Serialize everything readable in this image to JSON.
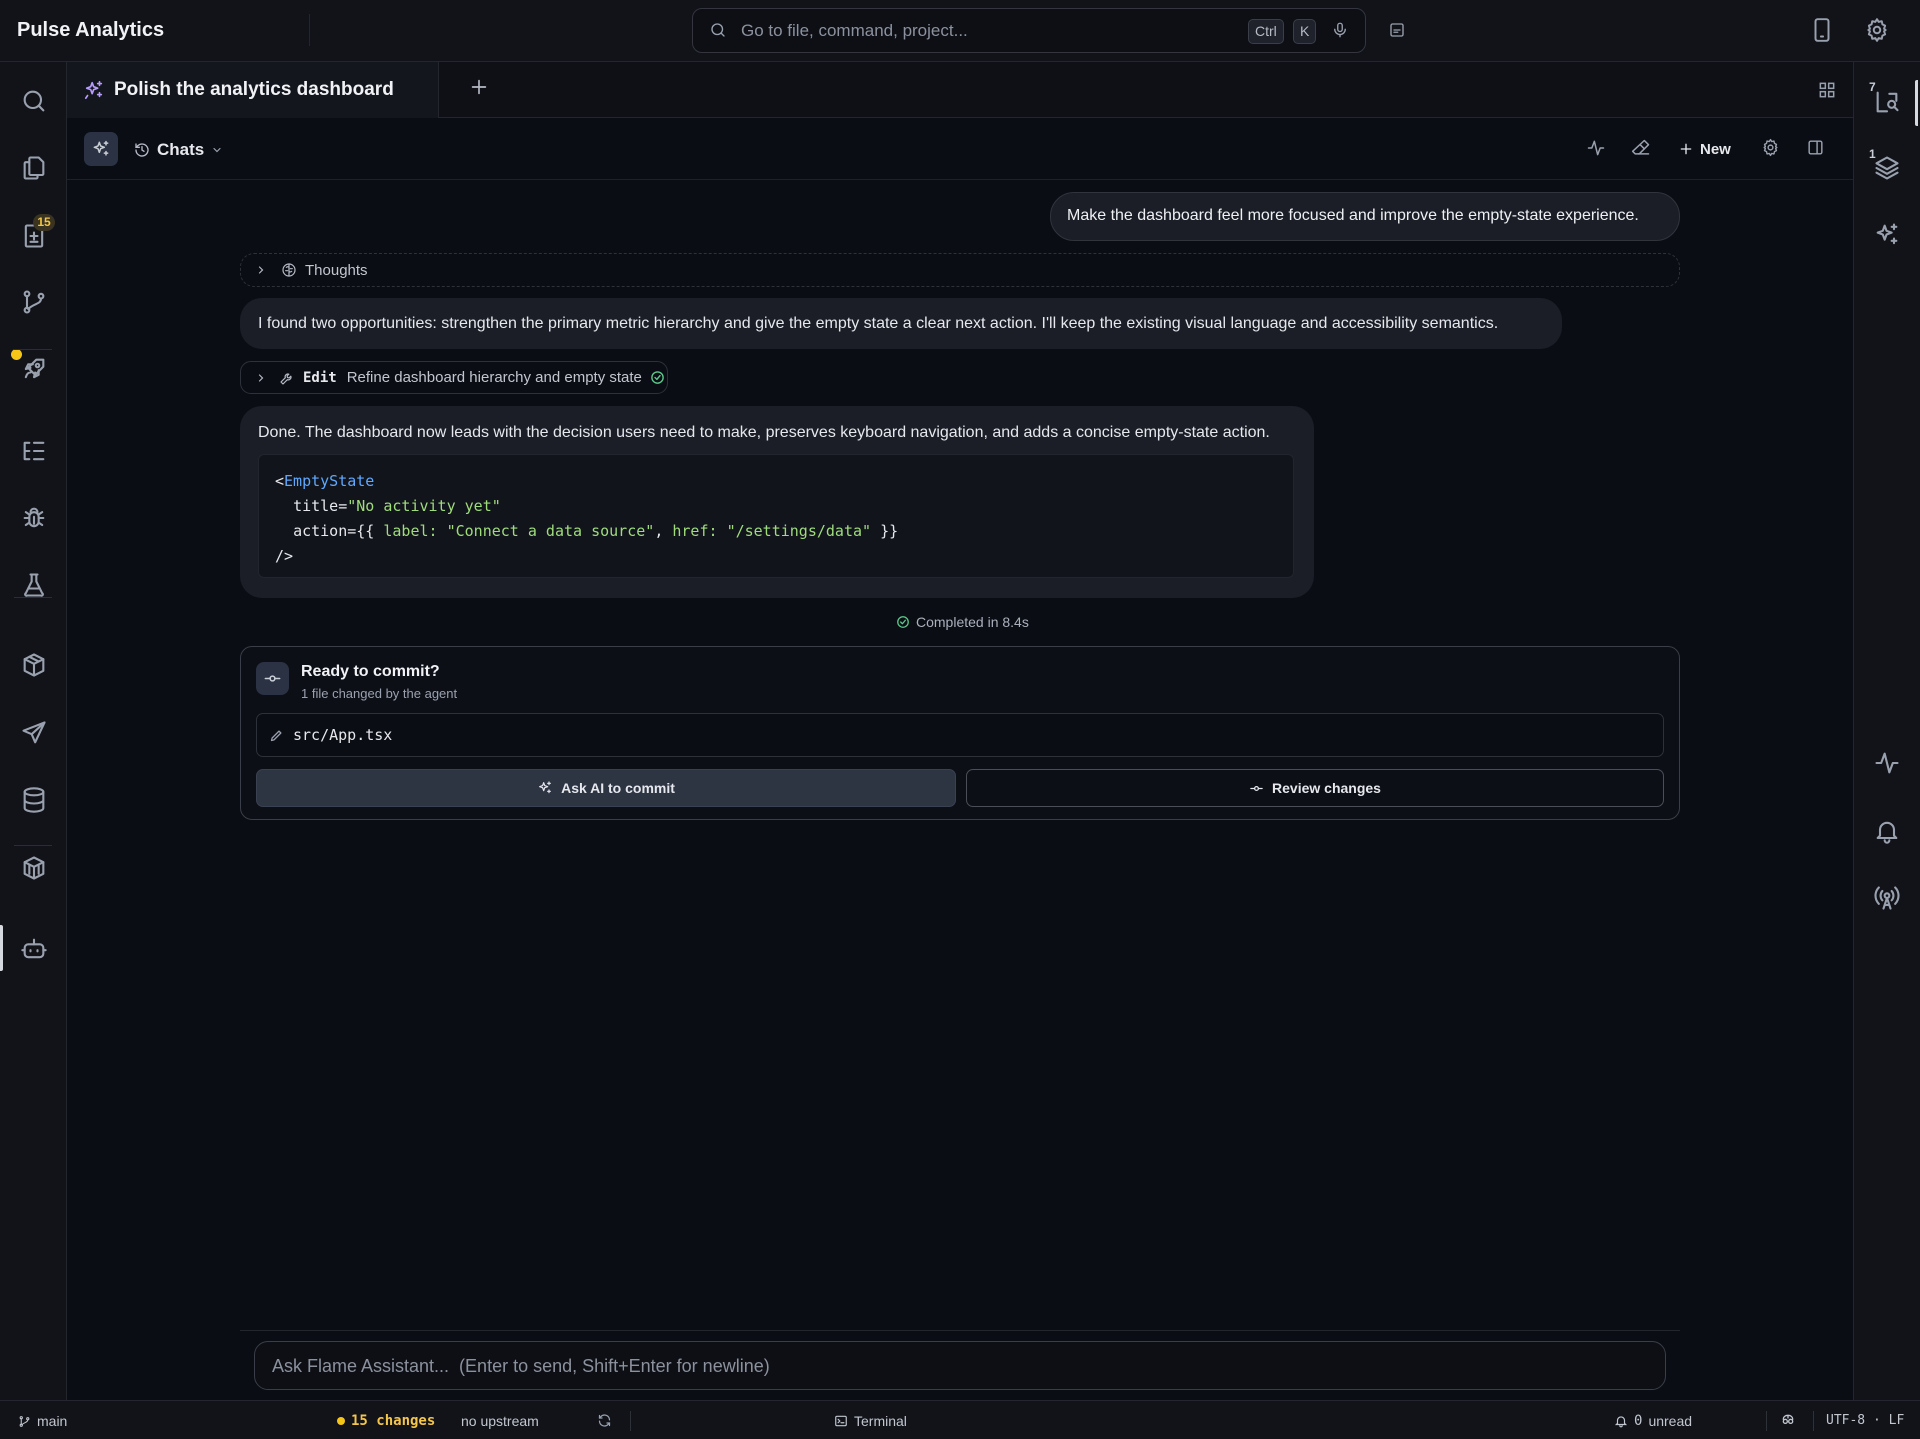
{
  "app": {
    "title": "Pulse Analytics"
  },
  "command_bar": {
    "placeholder": "Go to file, command, project...",
    "shortcut_ctrl": "Ctrl",
    "shortcut_key": "K"
  },
  "left_bar": {
    "changes_badge": "15"
  },
  "right_bar": {
    "badge_top": "7",
    "badge_layers": "1"
  },
  "tab": {
    "title": "Polish the analytics dashboard"
  },
  "chat_toolbar": {
    "chats_label": "Chats",
    "new_label": "New"
  },
  "messages": {
    "user_1": "Make the dashboard feel more focused and improve the empty-state experience.",
    "thoughts_label": "Thoughts",
    "assistant_1": "I found two opportunities: strengthen the primary metric hierarchy and give the empty state a clear next action. I'll keep the existing visual language and accessibility semantics.",
    "edit_keyword": "Edit",
    "edit_description": "Refine dashboard hierarchy and empty state",
    "assistant_2": "Done. The dashboard now leads with the decision users need to make, preserves keyboard navigation, and adds a concise empty-state action.",
    "code": {
      "open_bracket": "<",
      "tag": "EmptyState",
      "title_attr": "title=",
      "title_value": "\"No activity yet\"",
      "action_attr": "action={{ ",
      "label_key": "label: ",
      "label_value": "\"Connect a data source\"",
      "comma": ", ",
      "href_key": "href: ",
      "href_value": "\"/settings/data\"",
      "action_close": " }}",
      "self_close": "/>"
    },
    "completed": "Completed in 8.4s"
  },
  "commit_card": {
    "title": "Ready to commit?",
    "subtitle": "1 file changed by the agent",
    "file": "src/App.tsx",
    "ask_ai_label": "Ask AI to commit",
    "review_label": "Review changes"
  },
  "composer": {
    "placeholder": "Ask Flame Assistant...  (Enter to send, Shift+Enter for newline)"
  },
  "status_bar": {
    "branch": "main",
    "changes": "15 changes",
    "upstream": "no upstream",
    "terminal": "Terminal",
    "unread_count": "0",
    "unread_label": "unread",
    "encoding": "UTF-8 · LF"
  },
  "colors": {
    "accent_yellow": "#f5c518",
    "code_tag": "#5fa8ff",
    "code_string": "#9fdc7c",
    "success": "#5cc98a"
  }
}
